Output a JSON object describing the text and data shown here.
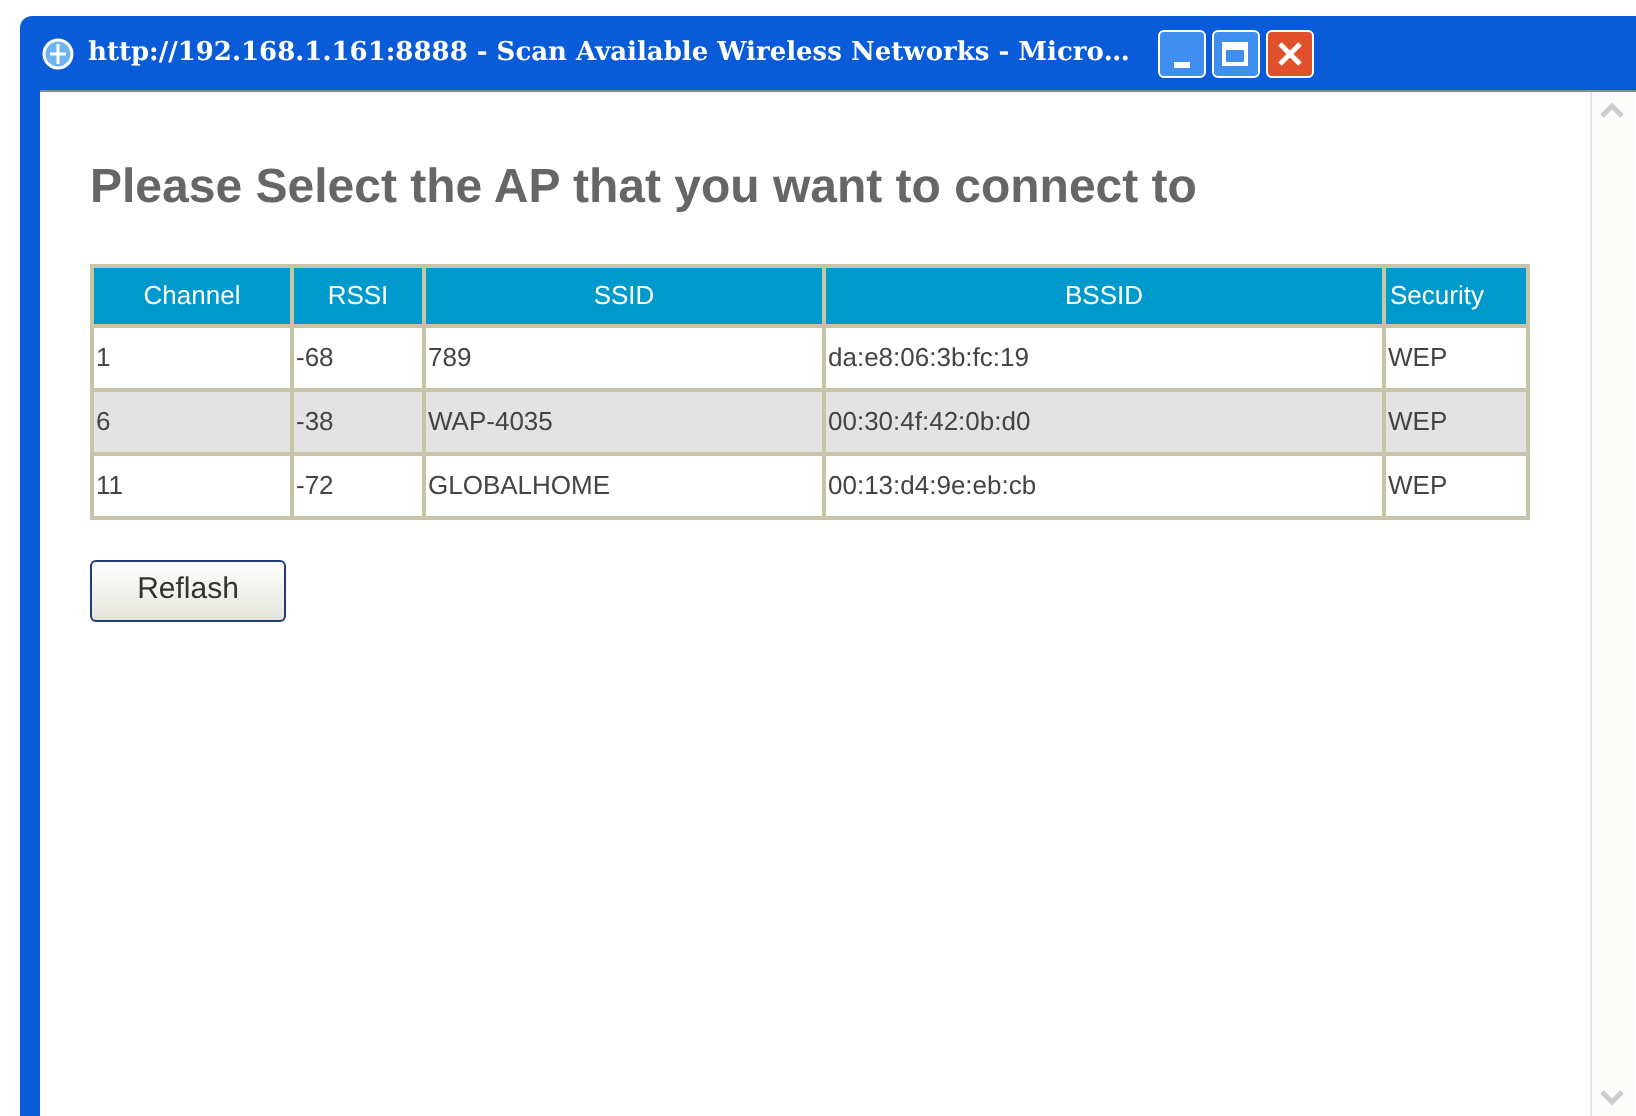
{
  "window": {
    "title": "http://192.168.1.161:8888 - Scan Available Wireless Networks - Micro…"
  },
  "heading": "Please Select the AP that you want to connect to",
  "table": {
    "columns": [
      "Channel",
      "RSSI",
      "SSID",
      "BSSID",
      "Security"
    ],
    "rows": [
      [
        "1",
        "-68",
        "789",
        "da:e8:06:3b:fc:19",
        "WEP"
      ],
      [
        "6",
        "-38",
        "WAP-4035",
        "00:30:4f:42:0b:d0",
        "WEP"
      ],
      [
        "11",
        "-72",
        "GLOBALHOME",
        "00:13:d4:9e:eb:cb",
        "WEP"
      ]
    ]
  },
  "button": "Reflash"
}
